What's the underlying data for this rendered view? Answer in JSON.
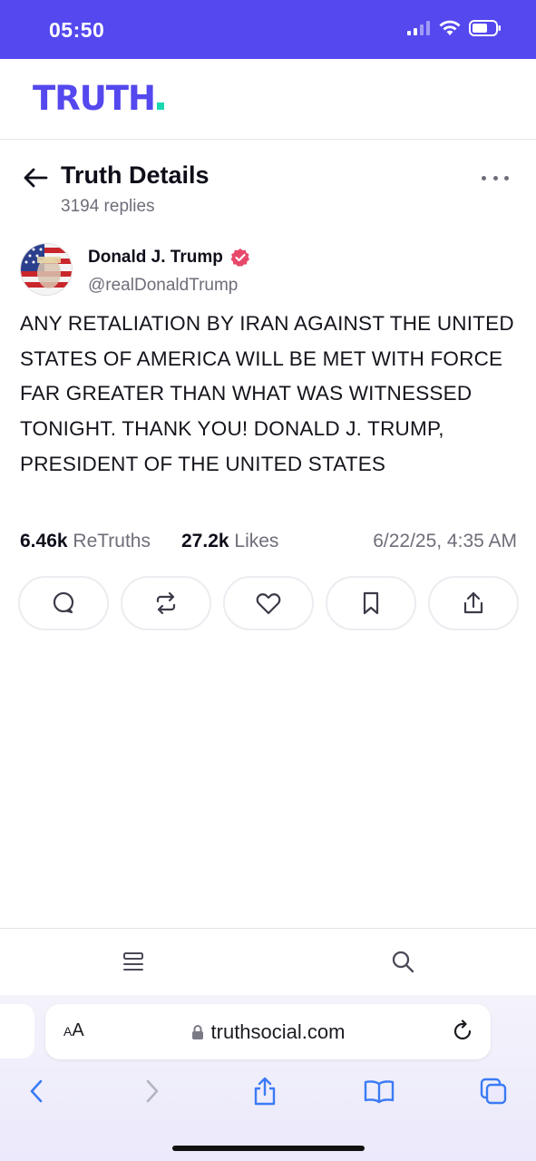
{
  "status_bar": {
    "time": "05:50"
  },
  "app": {
    "logo": "TRUTH"
  },
  "detail": {
    "title": "Truth Details",
    "replies": "3194 replies"
  },
  "post": {
    "author_name": "Donald J. Trump",
    "author_handle": "@realDonaldTrump",
    "text": "ANY RETALIATION BY IRAN AGAINST THE UNITED STATES OF AMERICA WILL BE MET WITH FORCE FAR GREATER THAN WHAT WAS WITNESSED TONIGHT. THANK YOU! DONALD J. TRUMP, PRESIDENT OF THE UNITED STATES",
    "retruths_count": "6.46k",
    "retruths_label": "ReTruths",
    "likes_count": "27.2k",
    "likes_label": "Likes",
    "timestamp": "6/22/25, 4:35 AM"
  },
  "actions": [
    "reply-icon",
    "retruth-icon",
    "like-icon",
    "bookmark-icon",
    "share-icon"
  ],
  "bottom_nav": {
    "items": [
      "menu-icon",
      "search-icon"
    ]
  },
  "browser": {
    "text_size_label_small": "A",
    "text_size_label_large": "A",
    "url": "truthsocial.com"
  },
  "colors": {
    "brand": "#5448ee",
    "accent": "#17d8b1",
    "verified": "#e8496b"
  }
}
